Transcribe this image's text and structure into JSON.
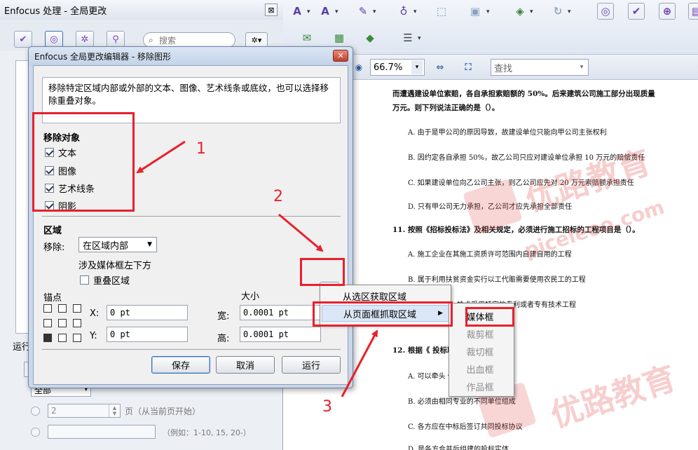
{
  "panel": {
    "title": "Enfocus 处理 - 全局更改",
    "close_label": "⊠",
    "search_placeholder": "搜索",
    "run_label": "运行",
    "scope_select": "全部",
    "page_count_value": "2",
    "page_label": "页（从当前页开始）",
    "range_hint": "（例如：1-10, 15, 20-）"
  },
  "toolbar": {
    "zoom_value": "66.7%",
    "find_placeholder": "查找"
  },
  "dialog": {
    "title": "Enfocus 全局更改编辑器 - 移除图形",
    "description": "移除特定区域内部或外部的文本、图像、艺术线条或底纹，也可以选择移除重叠对象。",
    "remove_objects": {
      "heading": "移除对象",
      "items": [
        {
          "label": "文本",
          "checked": true
        },
        {
          "label": "图像",
          "checked": true
        },
        {
          "label": "艺术线条",
          "checked": true
        },
        {
          "label": "阴影",
          "checked": true
        }
      ]
    },
    "region": {
      "heading": "区域",
      "remove_label": "移除:",
      "remove_value": "在区域内部",
      "media_box_note": "涉及媒体框左下方",
      "overlap_label": "重叠区域",
      "overlap_checked": false
    },
    "anchor_label": "锚点",
    "size_label": "大小",
    "x_label": "X:",
    "y_label": "Y:",
    "width_label": "宽:",
    "height_label": "高:",
    "x_value": "0 pt",
    "y_value": "0 pt",
    "width_value": "0.0001 pt",
    "height_value": "0.0001 pt",
    "buttons": {
      "save": "保存",
      "cancel": "取消",
      "run": "运行"
    }
  },
  "context_menu": {
    "items": [
      {
        "label": "从选区获取区域",
        "has_submenu": false
      },
      {
        "label": "从页面框抓取区域",
        "has_submenu": true
      }
    ],
    "submenu": [
      {
        "label": "媒体框",
        "enabled": true
      },
      {
        "label": "裁剪框",
        "enabled": false
      },
      {
        "label": "裁切框",
        "enabled": false
      },
      {
        "label": "出血框",
        "enabled": false
      },
      {
        "label": "作品框",
        "enabled": false
      }
    ]
  },
  "annotations": {
    "label_1": "1",
    "label_2": "2",
    "label_3": "3",
    "color": "#e8202a"
  },
  "document": {
    "lines": [
      "而遭遇建设单位索赔，各自承担索赔额的 50%。后来建筑公司施工部分出现质量",
      "万元。则下列说法正确的是（）。",
      "A. 由于是甲公司的原因导致，故建设单位只能向甲公司主张权利",
      "B. 因约定各自承担 50%，故乙公司只应对建设单位承担 10 万元的赔偿责任",
      "C. 如果建设单位向乙公司主张，则乙公司应先对 20 万元索赔额承担责任",
      "D. 只有甲公司无力承担，乙公司才应先承担全部责任",
      "11. 按照《招标投标法》及相关规定，必须进行施工招标的工程项目是（）。",
      "A. 施工企业在其施工资质许可范围内自建自用的工程",
      "B. 属于利用扶贫资金实行以工代赈需要使用农民工的工程",
      "技术采用特定的专利或者专有技术工程",
      "12. 根据《        投标联合体（    ）。",
      "A. 可以牵头                保证金",
      "B. 必须由相同专业的不同单位组成",
      "C. 各方应在中标后签订共同投标协议",
      "D. 是各方合并后组建的投标实体"
    ],
    "watermarks": [
      "优路教育",
      "piceleoo.com",
      "优路教育"
    ]
  }
}
